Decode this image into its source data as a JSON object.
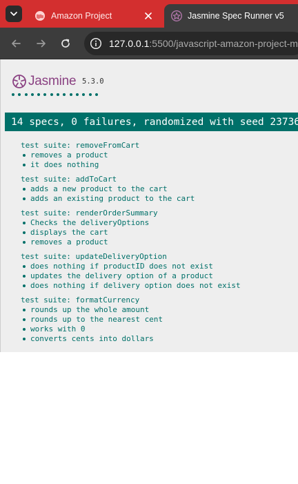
{
  "browser": {
    "tabs": [
      {
        "title": "Amazon Project",
        "active": false
      },
      {
        "title": "Jasmine Spec Runner v5",
        "active": true
      }
    ],
    "url_host": "127.0.0.1",
    "url_rest": ":5500/javascript-amazon-project-ma"
  },
  "jasmine": {
    "logo_text": "Jasmine",
    "version": "5.3.0",
    "passed_dot_count": 14,
    "summary": "14 specs, 0 failures, randomized with seed 23736",
    "suites": [
      {
        "name": "test suite: removeFromCart",
        "specs": [
          "removes a product",
          "it does nothing"
        ]
      },
      {
        "name": "test suite: addToCart",
        "specs": [
          "adds a new product to the cart",
          "adds an existing product to the cart"
        ]
      },
      {
        "name": "test suite: renderOrderSummary",
        "specs": [
          "Checks the deliveryOptions",
          "displays the cart",
          "removes a product"
        ]
      },
      {
        "name": "test suite: updateDeliveryOption",
        "specs": [
          "does nothing if productID does not exist",
          "updates the delivery option of a product",
          "does nothing if delivery option does not exist"
        ]
      },
      {
        "name": "test suite: formatCurrency",
        "specs": [
          "rounds up the whole amount",
          "rounds up to the nearest cent",
          "works with 0",
          "converts cents into dollars"
        ]
      }
    ]
  },
  "colors": {
    "tabstrip": "#d32f2f",
    "passed": "#007069",
    "jasmine_purple": "#8a4182"
  },
  "icons": {
    "tab_search": "chevron-down-icon",
    "inactive_favicon": "globe-icon",
    "active_favicon": "jasmine-flower-icon",
    "back": "arrow-left-icon",
    "forward": "arrow-right-icon",
    "reload": "reload-icon",
    "site_info": "site-info-icon"
  }
}
